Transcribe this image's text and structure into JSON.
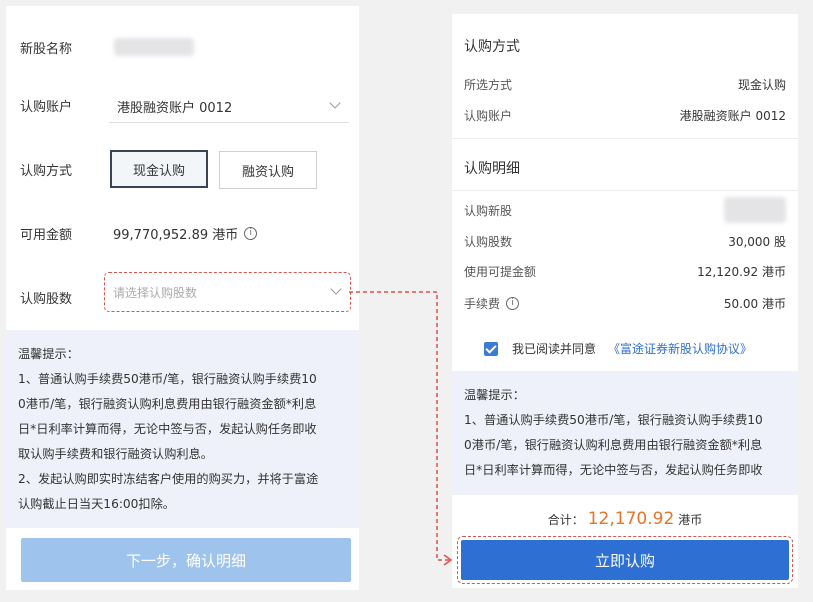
{
  "left": {
    "stock_name_label": "新股名称",
    "account_label": "认购账户",
    "account_value": "港股融资账户 0012",
    "method_label": "认购方式",
    "method_options": [
      "现金认购",
      "融资认购"
    ],
    "method_selected": "现金认购",
    "available_label": "可用金额",
    "available_value": "99,770,952.89 港币",
    "shares_label": "认购股数",
    "shares_placeholder": "请选择认购股数",
    "tips": {
      "title": "温馨提示：",
      "lines": [
        "1、普通认购手续费50港币/笔，银行融资认购手续费10",
        "0港币/笔，银行融资认购利息费用由银行融资金额*利息",
        "日*日利率计算而得，无论中签与否，发起认购任务即收",
        "取认购手续费和银行融资认购利息。",
        "2、发起认购即实时冻结客户使用的购买力，并将于富途",
        "认购截止日当天16:00扣除。"
      ]
    },
    "next_button": "下一步，确认明细"
  },
  "right": {
    "method_section_title": "认购方式",
    "selected_method_label": "所选方式",
    "selected_method_value": "现金认购",
    "account_label": "认购账户",
    "account_value": "港股融资账户 0012",
    "detail_section_title": "认购明细",
    "new_stock_label": "认购新股",
    "shares_label": "认购股数",
    "shares_value": "30,000 股",
    "withdrawable_label": "使用可提金额",
    "withdrawable_value": "12,120.92 港币",
    "fee_label": "手续费",
    "fee_value": "50.00 港币",
    "agree_text": "我已阅读并同意",
    "agreement_link": "《富途证券新股认购协议》",
    "tips": {
      "title": "温馨提示：",
      "lines": [
        "1、普通认购手续费50港币/笔，银行融资认购手续费10",
        "0港币/笔，银行融资认购利息费用由银行融资金额*利息",
        "日*日利率计算而得，无论中签与否，发起认购任务即收"
      ]
    },
    "total_label": "合计：",
    "total_value": "12,170.92",
    "total_unit": "港币",
    "submit_button": "立即认购"
  },
  "icons": {
    "info": "info-icon",
    "dropdown": "chevron-down-icon",
    "check": "checkbox-checked-icon"
  },
  "colors": {
    "primary": "#2d6fd2",
    "disabled": "#9ec3ec",
    "accent_total": "#e8732a",
    "annotation": "#d9534f"
  }
}
